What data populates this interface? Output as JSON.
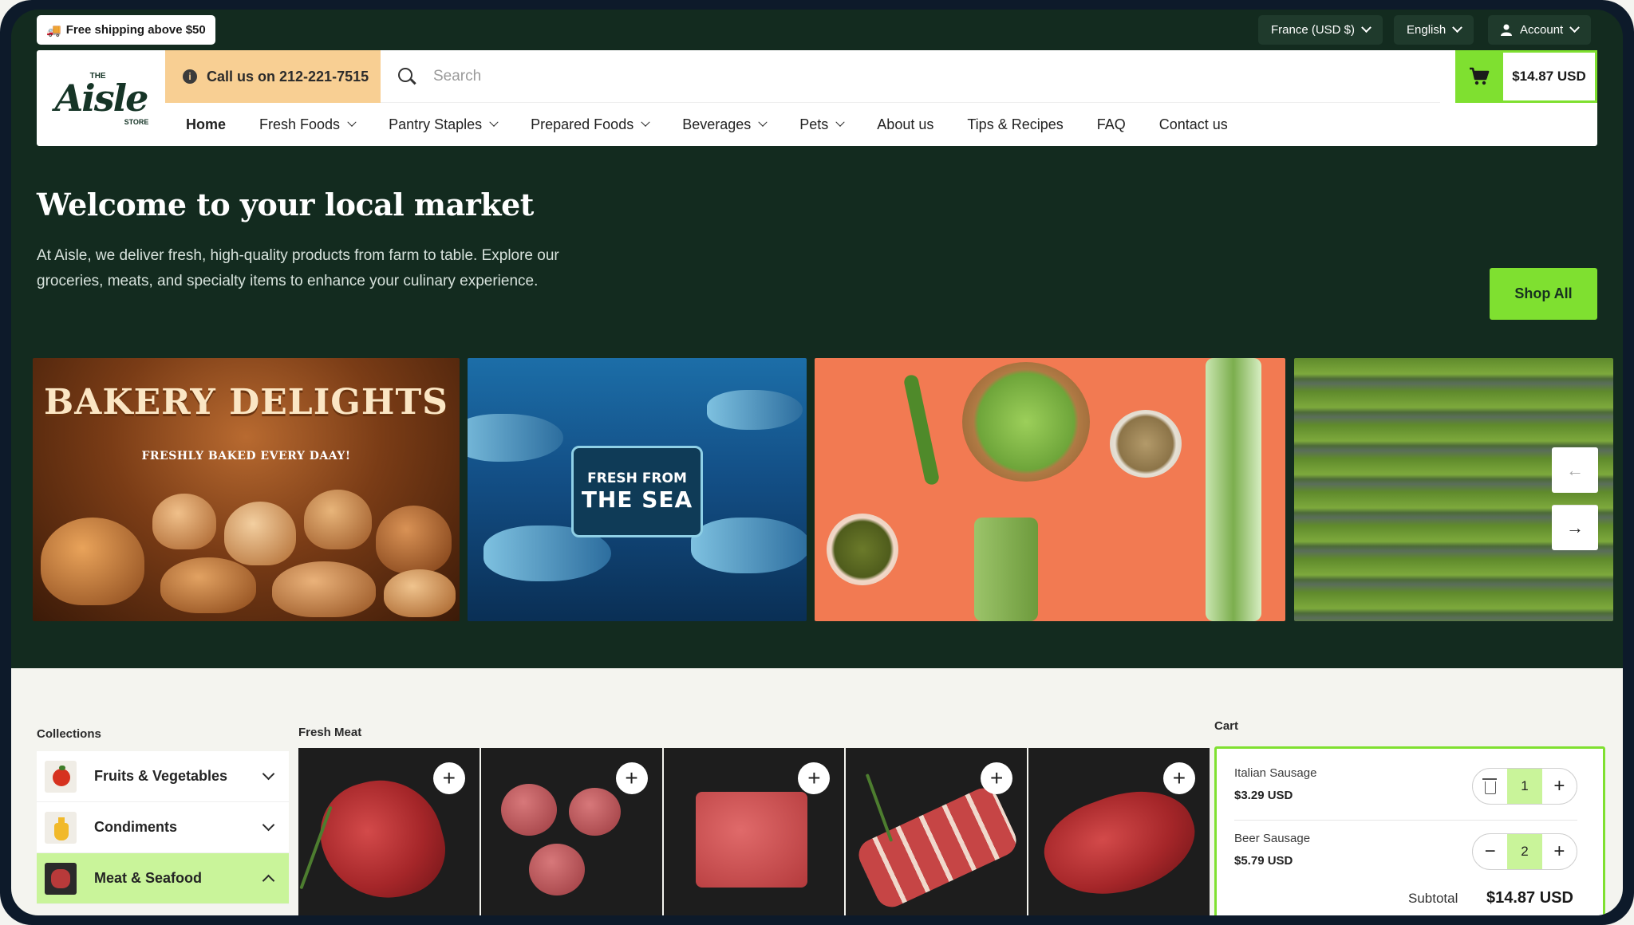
{
  "topbar": {
    "shipping_text": "Free shipping above $50",
    "region": "France (USD $)",
    "language": "English",
    "account": "Account"
  },
  "header": {
    "logo_word": "Aisle",
    "logo_the": "THE",
    "logo_store": "STORE",
    "call_text": "Call us on 212-221-7515",
    "search_placeholder": "Search",
    "cart_total": "$14.87 USD"
  },
  "nav": {
    "items": [
      {
        "label": "Home",
        "dropdown": false,
        "active": true
      },
      {
        "label": "Fresh Foods",
        "dropdown": true
      },
      {
        "label": "Pantry Staples",
        "dropdown": true
      },
      {
        "label": "Prepared Foods",
        "dropdown": true
      },
      {
        "label": "Beverages",
        "dropdown": true
      },
      {
        "label": "Pets",
        "dropdown": true
      },
      {
        "label": "About us",
        "dropdown": false
      },
      {
        "label": "Tips & Recipes",
        "dropdown": false
      },
      {
        "label": "FAQ",
        "dropdown": false
      },
      {
        "label": "Contact us",
        "dropdown": false
      }
    ]
  },
  "hero": {
    "title": "Welcome to your local market",
    "description": "At Aisle, we deliver fresh, high-quality products from farm to table. Explore our groceries, meats, and specialty items to enhance your culinary experience.",
    "shop_all": "Shop All"
  },
  "banners": {
    "bakery_title": "Bakery Delights",
    "bakery_subtitle": "FRESHLY BAKED EVERY DAAY!",
    "sea_small": "FRESH FROM",
    "sea_big": "THE SEA",
    "prev_arrow": "←",
    "next_arrow": "→"
  },
  "collections": {
    "label": "Collections",
    "items": [
      {
        "name": "Fruits & Vegetables",
        "expanded": false
      },
      {
        "name": "Condiments",
        "expanded": false
      },
      {
        "name": "Meat & Seafood",
        "expanded": true
      }
    ]
  },
  "fresh_meat": {
    "label": "Fresh Meat",
    "add_symbol": "+"
  },
  "cart": {
    "label": "Cart",
    "items": [
      {
        "name": "Italian Sausage",
        "price": "$3.29 USD",
        "qty": "1"
      },
      {
        "name": "Beer Sausage",
        "price": "$5.79 USD",
        "qty": "2"
      }
    ],
    "subtotal_label": "Subtotal",
    "subtotal": "$14.87 USD",
    "minus_symbol": "−",
    "plus_symbol": "+"
  },
  "colors": {
    "accent_green": "#7fe030",
    "dark_green": "#132b1f",
    "call_orange": "#f8cf93",
    "selected_green": "#c9f49a"
  }
}
